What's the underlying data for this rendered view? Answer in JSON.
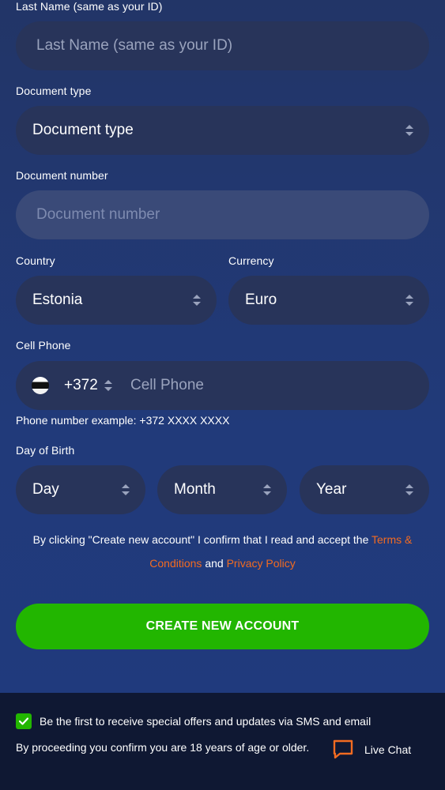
{
  "form": {
    "last_name": {
      "label": "Last Name (same as your ID)",
      "placeholder": "Last Name (same as your ID)"
    },
    "document_type": {
      "label": "Document type",
      "value": "Document type"
    },
    "document_number": {
      "label": "Document number",
      "placeholder": "Document number"
    },
    "country": {
      "label": "Country",
      "value": "Estonia"
    },
    "currency": {
      "label": "Currency",
      "value": "Euro"
    },
    "cell_phone": {
      "label": "Cell Phone",
      "dial_code": "+372",
      "placeholder": "Cell Phone",
      "example": "Phone number example: +372 XXXX XXXX"
    },
    "birth": {
      "label": "Day of Birth",
      "day": "Day",
      "month": "Month",
      "year": "Year"
    },
    "terms": {
      "prefix": "By clicking \"Create new account\" I confirm that I read and accept the",
      "terms_link": "Terms & Conditions",
      "and": "and",
      "privacy_link": "Privacy Policy"
    },
    "submit_label": "CREATE NEW ACCOUNT"
  },
  "footer": {
    "offers_opt_in": "Be the first to receive special offers and updates via SMS and email",
    "age_notice": "By proceeding you confirm you are 18 years of age or older.",
    "live_chat": "Live Chat"
  },
  "colors": {
    "accent_orange": "#f26b21",
    "cta_green": "#22b600",
    "field_bg": "#28345a"
  }
}
